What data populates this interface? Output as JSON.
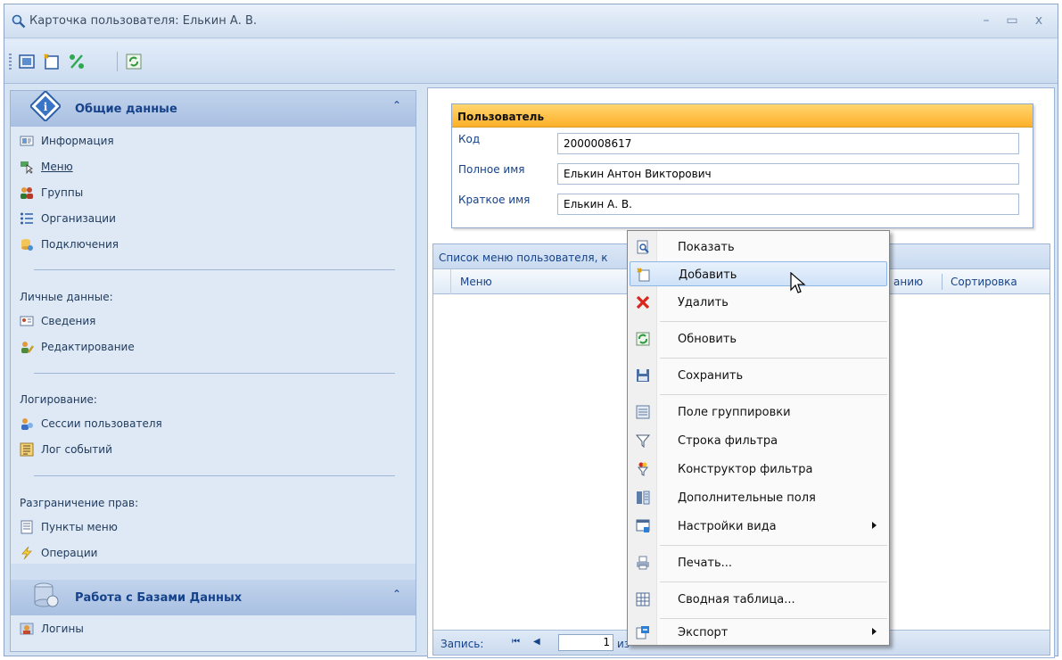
{
  "window": {
    "title": "Карточка пользователя: Елькин А. В.",
    "controls": {
      "minimize": "–",
      "maximize": "▭",
      "close": "x"
    }
  },
  "toolbar": {
    "buttons": [
      "open-icon",
      "new-icon",
      "percent-edit-icon",
      "refresh-icon"
    ]
  },
  "nav": {
    "general": {
      "title": "Общие данные",
      "items": [
        {
          "label": "Информация",
          "icon": "info-card-icon"
        },
        {
          "label": "Меню",
          "icon": "menu-cursor-icon"
        },
        {
          "label": "Группы",
          "icon": "groups-icon"
        },
        {
          "label": "Организации",
          "icon": "list-icon"
        },
        {
          "label": "Подключения",
          "icon": "connection-icon"
        }
      ],
      "personal_title": "Личные данные:",
      "personal": [
        {
          "label": "Сведения",
          "icon": "id-card-icon"
        },
        {
          "label": "Редактирование",
          "icon": "user-edit-icon"
        }
      ],
      "logging_title": "Логирование:",
      "logging": [
        {
          "label": "Сессии пользователя",
          "icon": "session-icon"
        },
        {
          "label": "Лог событий",
          "icon": "event-log-icon"
        }
      ],
      "rights_title": "Разграничение прав:",
      "rights": [
        {
          "label": "Пункты меню",
          "icon": "document-icon"
        },
        {
          "label": "Операции",
          "icon": "lightning-icon"
        }
      ]
    },
    "db": {
      "title": "Работа с Базами Данных",
      "items": [
        {
          "label": "Логины",
          "icon": "login-icon"
        }
      ]
    }
  },
  "user": {
    "header": "Пользователь",
    "fields": [
      {
        "label": "Код",
        "value": "2000008617"
      },
      {
        "label": "Полное имя",
        "value": "Елькин Антон Викторович"
      },
      {
        "label": "Краткое имя",
        "value": "Елькин А. В."
      }
    ]
  },
  "grid": {
    "caption": "Список меню пользователя, к",
    "columns": [
      "Меню",
      "анию",
      "Сортировка"
    ],
    "footer": {
      "record_label": "Запись:",
      "current": "1",
      "of": "из"
    }
  },
  "context_menu": {
    "items": [
      {
        "label": "Показать",
        "icon": "preview-icon"
      },
      {
        "label": "Добавить",
        "icon": "add-icon",
        "highlighted": true
      },
      {
        "label": "Удалить",
        "icon": "delete-x-icon"
      },
      {
        "label": "Обновить",
        "icon": "refresh-icon"
      },
      {
        "label": "Сохранить",
        "icon": "save-icon"
      },
      {
        "label": "Поле группировки",
        "icon": "group-field-icon"
      },
      {
        "label": "Строка фильтра",
        "icon": "filter-icon"
      },
      {
        "label": "Конструктор фильтра",
        "icon": "filter-builder-icon"
      },
      {
        "label": "Дополнительные поля",
        "icon": "columns-icon"
      },
      {
        "label": "Настройки вида",
        "icon": "view-settings-icon",
        "submenu": true
      },
      {
        "label": "Печать...",
        "icon": "print-icon"
      },
      {
        "label": "Сводная таблица...",
        "icon": "pivot-icon"
      },
      {
        "label": "Экспорт",
        "icon": "export-icon",
        "submenu": true
      }
    ]
  },
  "colors": {
    "accent_orange": "#ffb02a",
    "nav_blue": "#15428b",
    "panel": "#dfe9f6"
  }
}
